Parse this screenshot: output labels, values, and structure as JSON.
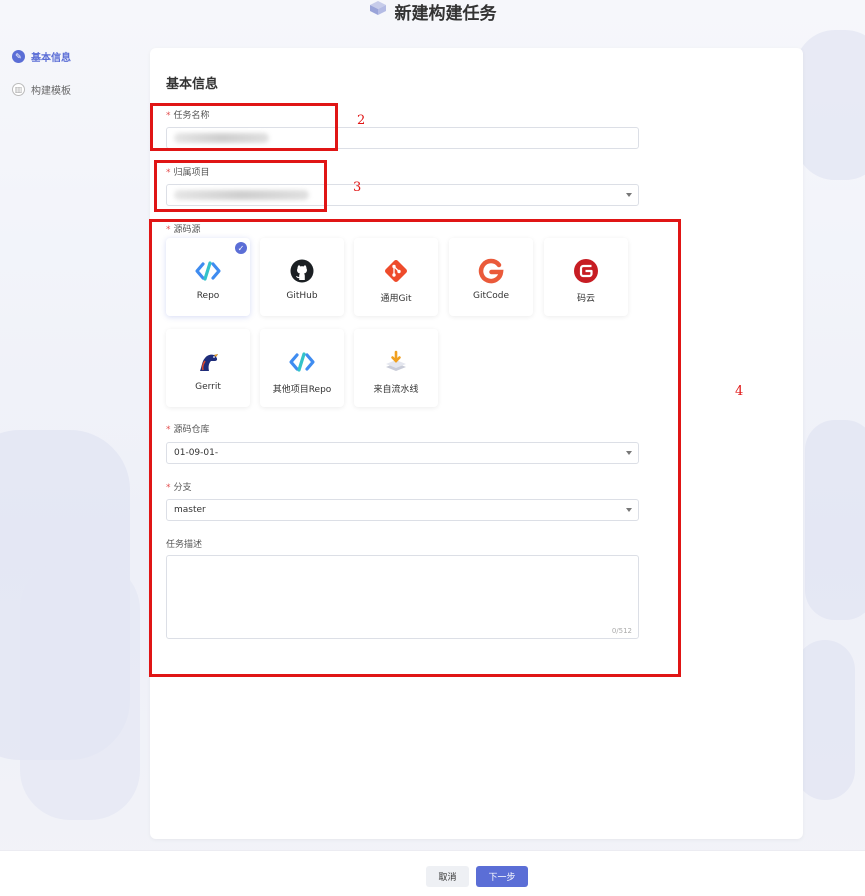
{
  "header": {
    "title": "新建构建任务"
  },
  "steps": [
    {
      "label": "基本信息",
      "active": true
    },
    {
      "label": "构建模板",
      "active": false
    }
  ],
  "form": {
    "section_title": "基本信息",
    "task_name": {
      "label": "任务名称",
      "required": "*"
    },
    "project": {
      "label": "归属项目",
      "required": "*"
    },
    "source": {
      "label": "源码源",
      "required": "*",
      "options": [
        {
          "label": "Repo",
          "icon": "repo-icon",
          "selected": true
        },
        {
          "label": "GitHub",
          "icon": "github-icon",
          "selected": false
        },
        {
          "label": "通用Git",
          "icon": "git-icon",
          "selected": false
        },
        {
          "label": "GitCode",
          "icon": "gitcode-icon",
          "selected": false
        },
        {
          "label": "码云",
          "icon": "gitee-icon",
          "selected": false
        },
        {
          "label": "Gerrit",
          "icon": "gerrit-icon",
          "selected": false
        },
        {
          "label": "其他项目Repo",
          "icon": "other-repo-icon",
          "selected": false
        },
        {
          "label": "来自流水线",
          "icon": "pipeline-icon",
          "selected": false
        }
      ]
    },
    "repository": {
      "label": "源码仓库",
      "required": "*",
      "value": "01-09-01-"
    },
    "branch": {
      "label": "分支",
      "required": "*",
      "value": "master"
    },
    "description": {
      "label": "任务描述",
      "counter": "0/512"
    }
  },
  "footer": {
    "cancel_label": "取消",
    "next_label": "下一步"
  },
  "annotations": [
    "2",
    "3",
    "4"
  ],
  "colors": {
    "accent": "#5b6ed6",
    "annotation": "#e01515",
    "required": "#e34d4d"
  }
}
